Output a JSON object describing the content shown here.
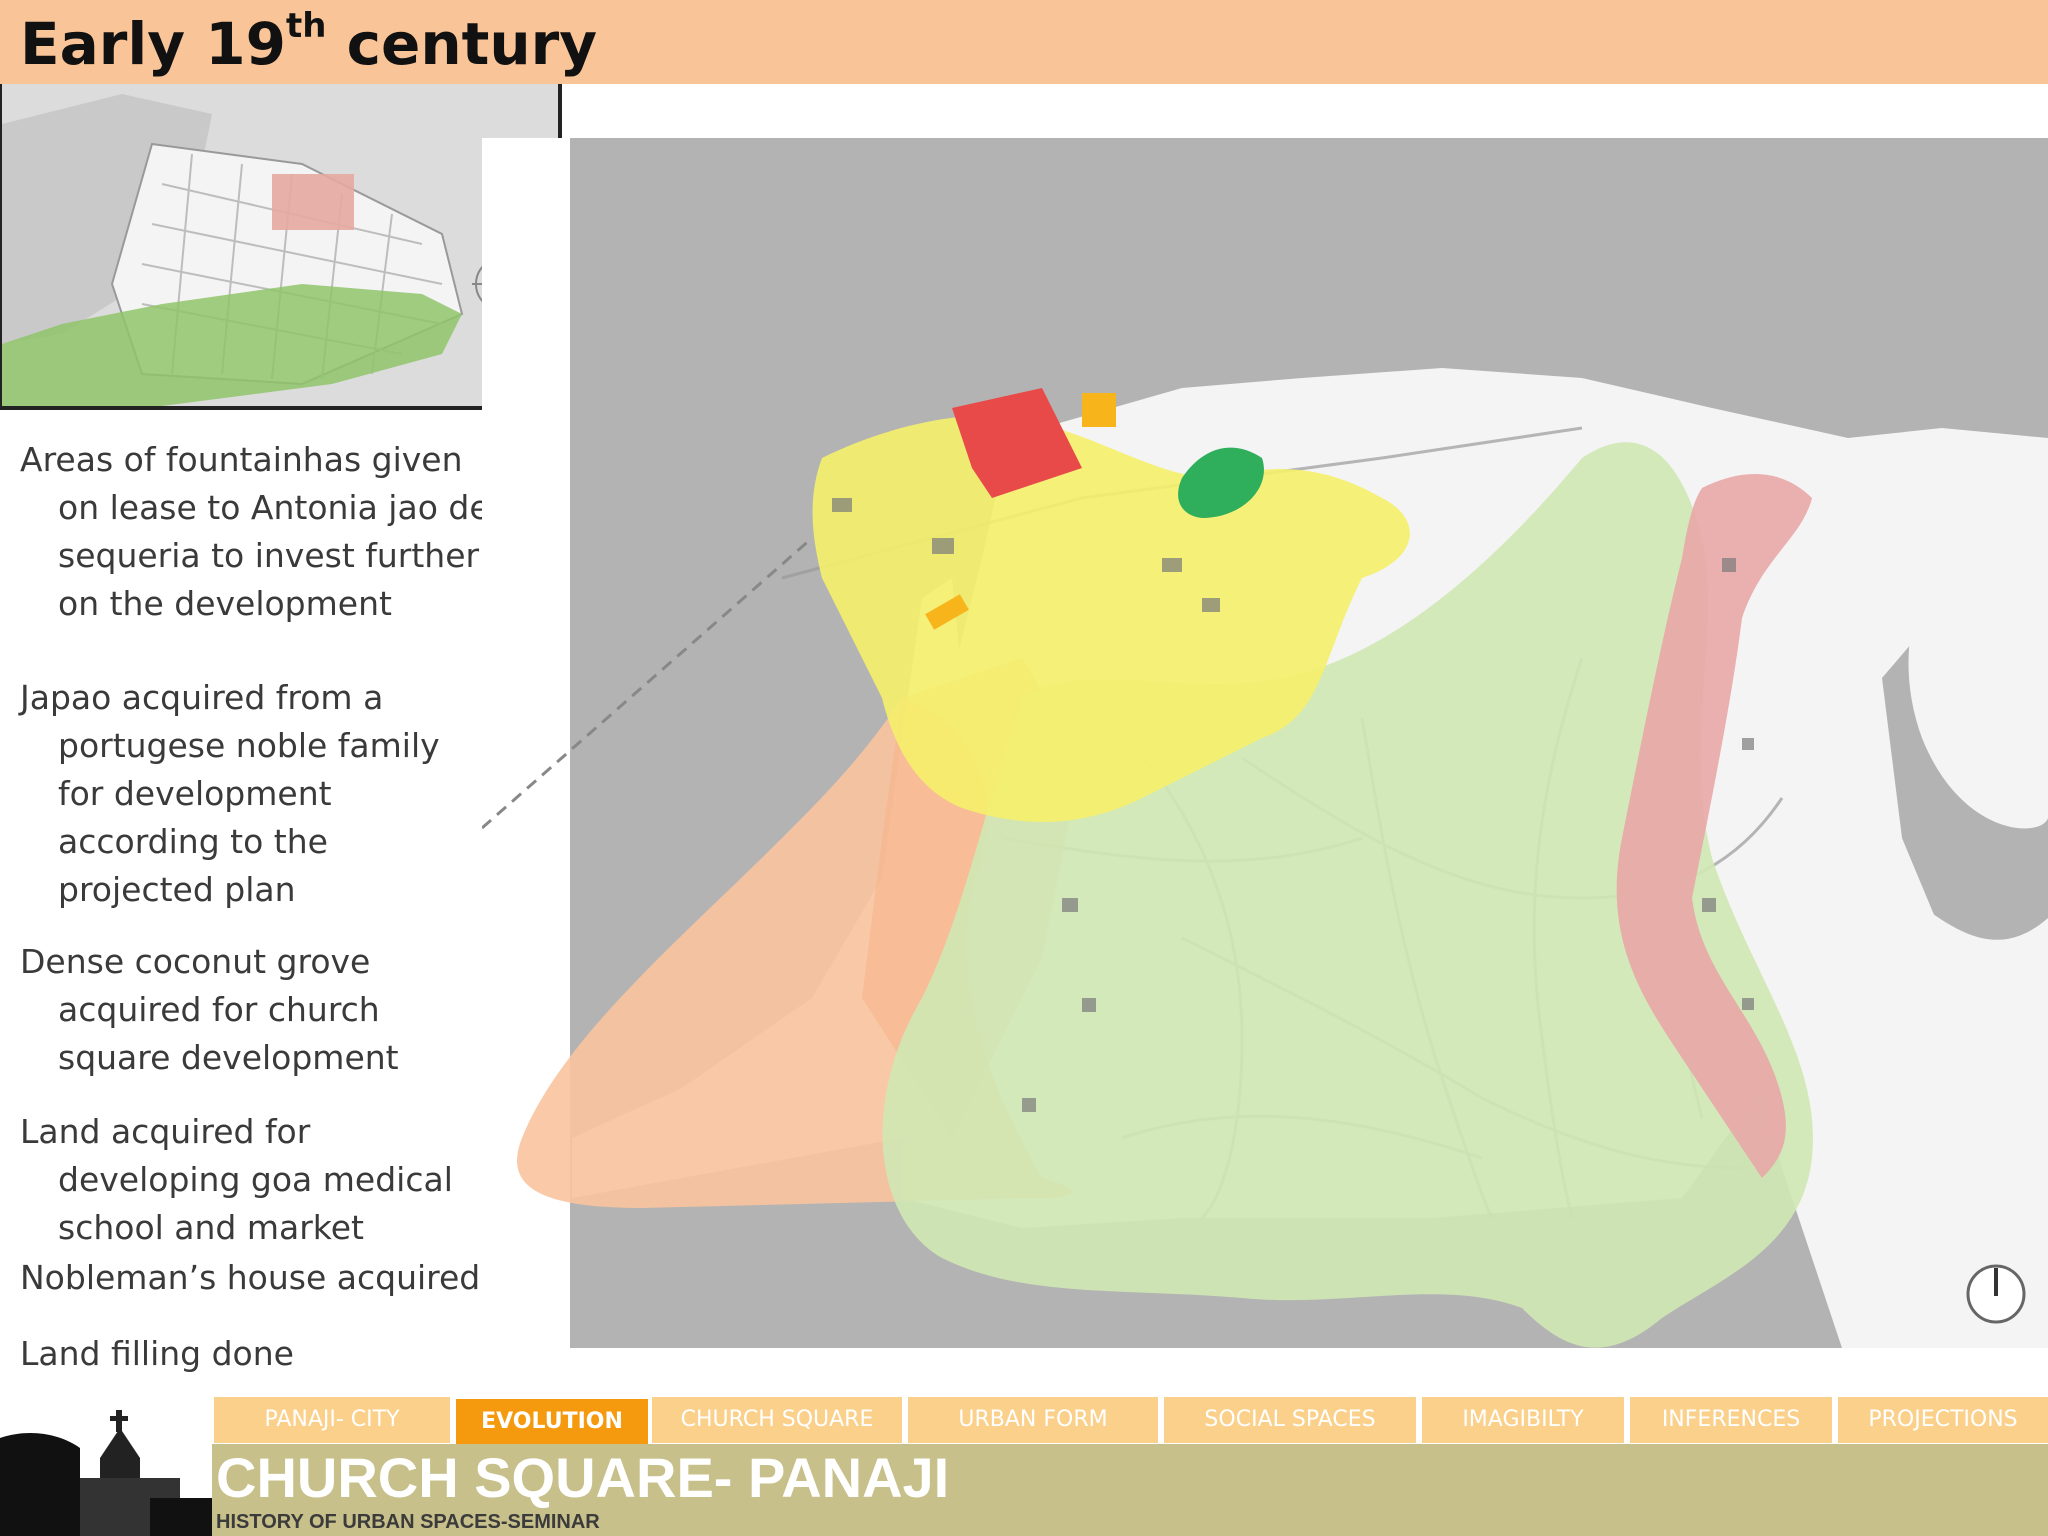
{
  "header": {
    "title_main": "Early 19",
    "title_sup": "th",
    "title_end": " century",
    "color": "#f9c497"
  },
  "notes": [
    "Areas of fountainhas given on lease to Antonia  jao de sequeria to invest further on the development",
    "Japao acquired from a portugese noble family for development according to the projected plan",
    "Dense coconut grove acquired for church square development",
    "Land acquired for developing goa medical school and market",
    "Nobleman’s house acquired",
    "Land filling done"
  ],
  "map_colors": {
    "water": "#b3b3b3",
    "yellow_zone": "#f5f06a",
    "green_zone": "#cfe8b4",
    "orange_zone": "#f9c49f",
    "pink_zone": "#e9a7a7",
    "red_block": "#e84a4a",
    "dark_green_block": "#2fae5b",
    "orange_block": "#f7b41b"
  },
  "nav": {
    "tabs": [
      {
        "label": "PANAJI- CITY",
        "active": false
      },
      {
        "label": "EVOLUTION",
        "active": true
      },
      {
        "label": "CHURCH SQUARE",
        "active": false
      },
      {
        "label": "URBAN FORM",
        "active": false
      },
      {
        "label": "SOCIAL SPACES",
        "active": false
      },
      {
        "label": "IMAGIBILTY",
        "active": false
      },
      {
        "label": "INFERENCES",
        "active": false
      },
      {
        "label": "PROJECTIONS",
        "active": false
      }
    ],
    "tab_color": "#fbd08a",
    "active_color": "#f59a0e"
  },
  "footer": {
    "title": "CHURCH SQUARE- PANAJI",
    "subtitle": "HISTORY OF URBAN SPACES-SEMINAR",
    "color": "#c8c08a"
  }
}
